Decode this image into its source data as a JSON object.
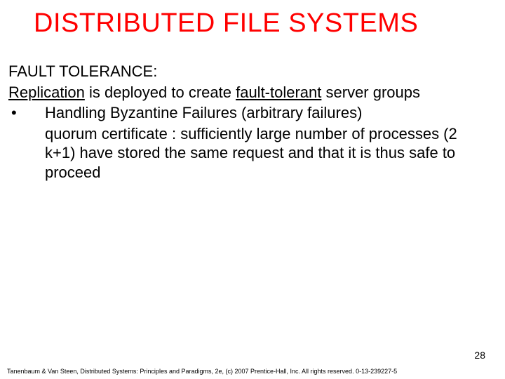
{
  "title": "DISTRIBUTED FILE SYSTEMS",
  "section_heading": "FAULT TOLERANCE:",
  "intro_before": "Replication",
  "intro_mid": " is deployed to create ",
  "intro_underlined": "fault-tolerant",
  "intro_after": " server groups",
  "bullet_mark": "•",
  "bullet_line1": "Handling Byzantine Failures (arbitrary failures)",
  "bullet_line2": "quorum certificate :  sufficiently large number of processes (2 k+1) have stored the same request and that it is thus safe to proceed",
  "page_number": "28",
  "footer": "Tanenbaum & Van Steen, Distributed Systems: Principles and Paradigms, 2e, (c) 2007 Prentice-Hall, Inc. All rights reserved. 0-13-239227-5"
}
